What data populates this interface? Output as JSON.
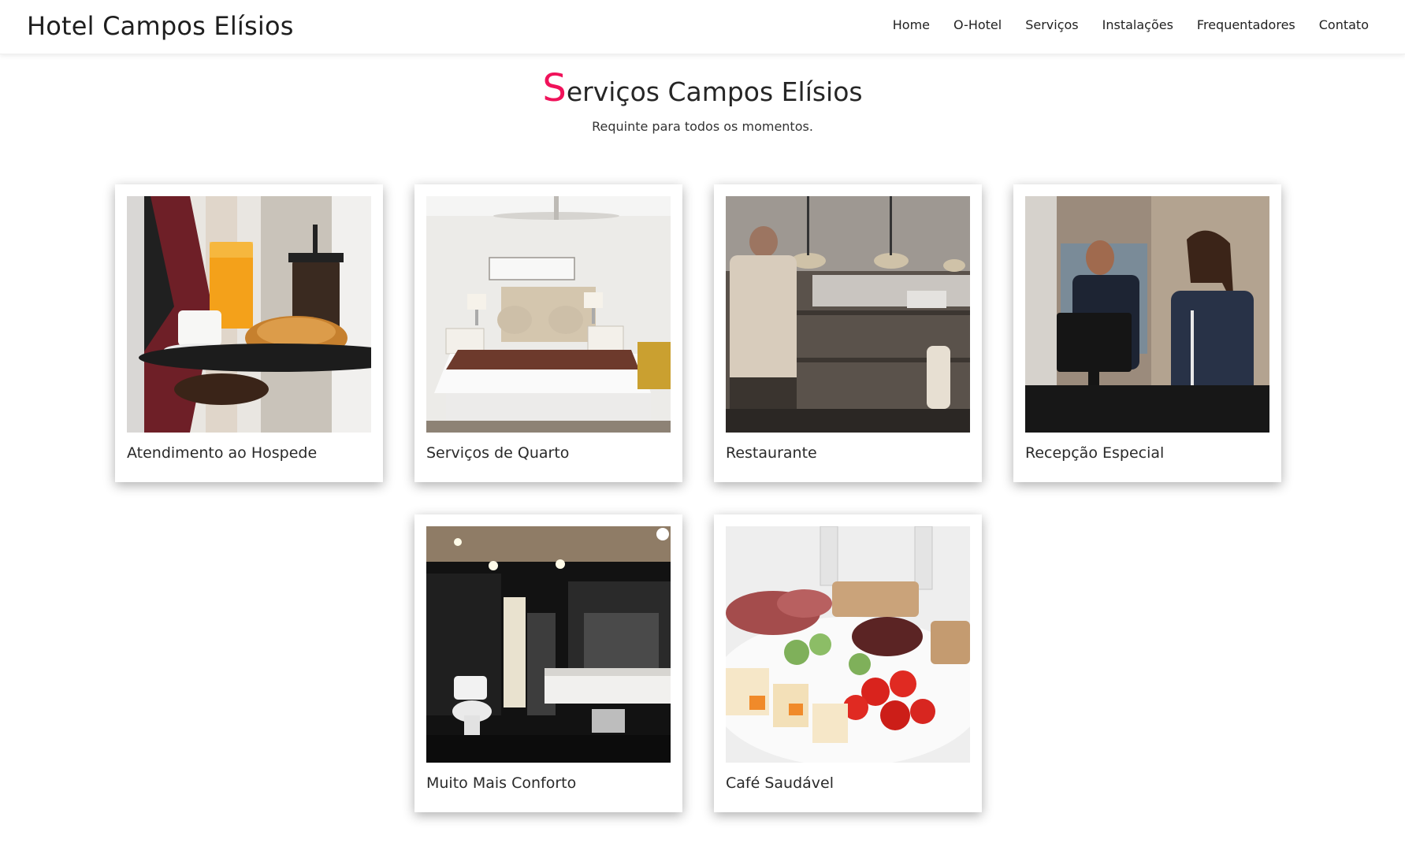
{
  "header": {
    "brand": "Hotel Campos Elísios",
    "nav": [
      "Home",
      "O-Hotel",
      "Serviços",
      "Instalações",
      "Frequentadores",
      "Contato"
    ]
  },
  "section": {
    "title_initial": "S",
    "title_rest": "erviços Campos Elísios",
    "subtitle": "Requinte para todos os momentos."
  },
  "cards": [
    {
      "label": "Atendimento ao Hospede"
    },
    {
      "label": "Serviços de Quarto"
    },
    {
      "label": "Restaurante"
    },
    {
      "label": "Recepção Especial"
    },
    {
      "label": "Muito Mais Conforto"
    },
    {
      "label": "Café Saudável"
    }
  ],
  "colors": {
    "accent": "#f0125a",
    "text": "#1f1f1f",
    "background": "#ffffff"
  }
}
